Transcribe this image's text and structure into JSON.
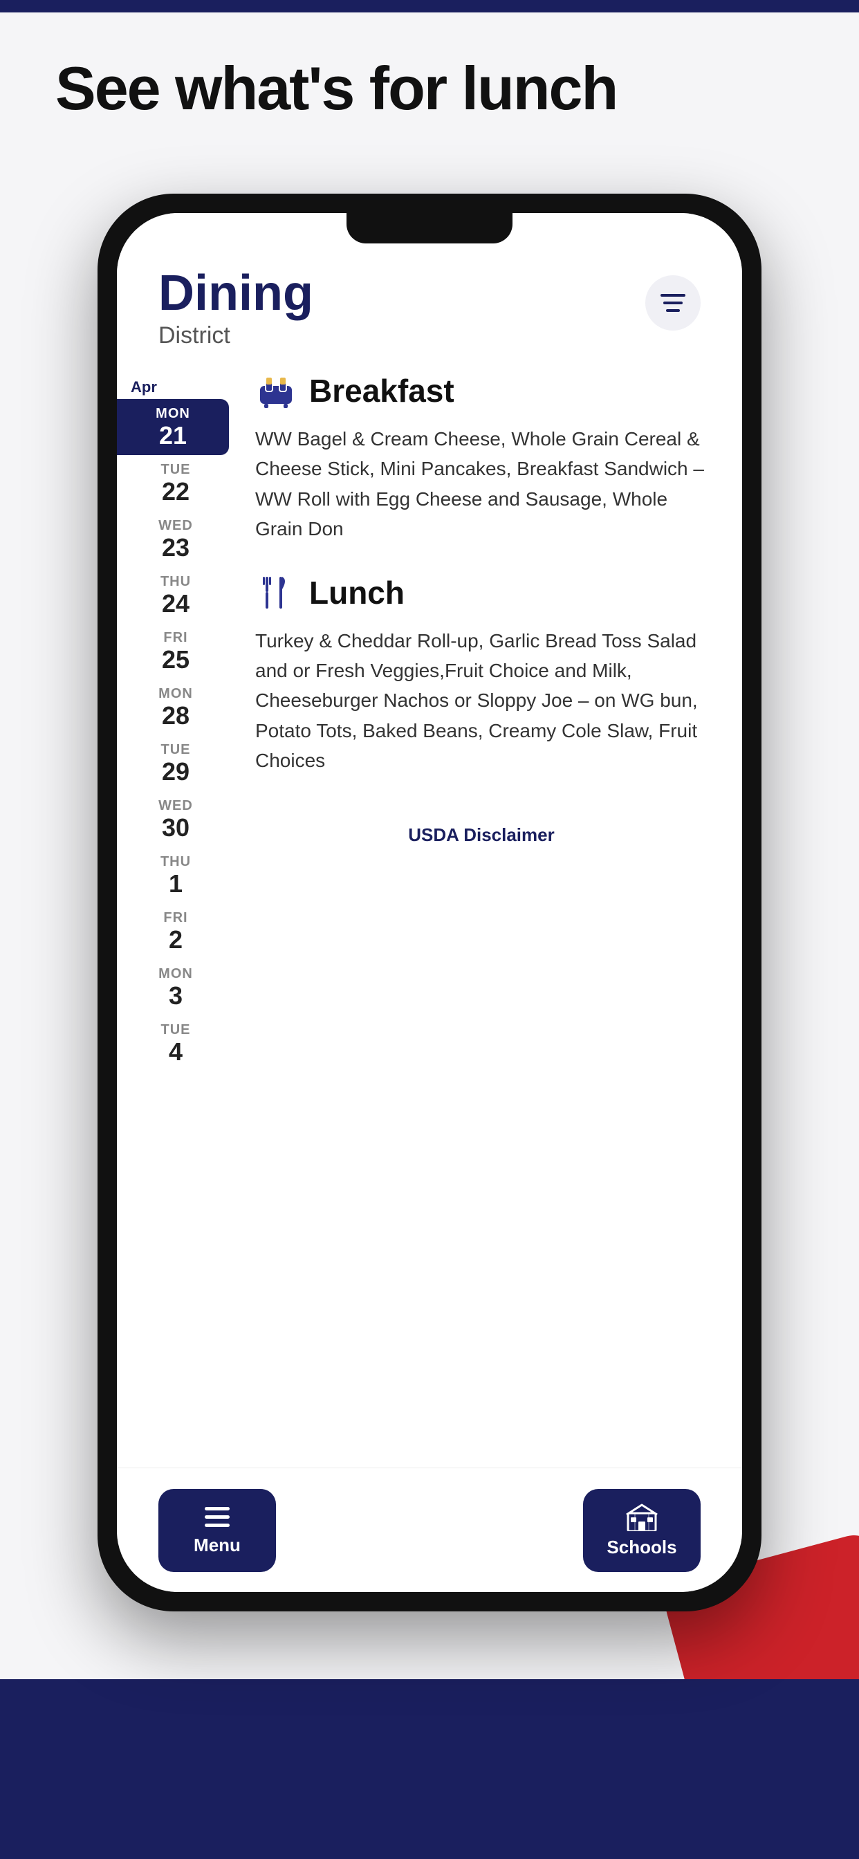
{
  "page": {
    "heading": "See what's for lunch",
    "top_bar_color": "#1a1f5e"
  },
  "app": {
    "title": "Dining",
    "subtitle": "District",
    "filter_label": "filter"
  },
  "calendar": {
    "month": "Apr",
    "days": [
      {
        "id": "mon-21",
        "day": "MON",
        "num": "21",
        "active": true
      },
      {
        "id": "tue-22",
        "day": "TUE",
        "num": "22",
        "active": false
      },
      {
        "id": "wed-23",
        "day": "WED",
        "num": "23",
        "active": false
      },
      {
        "id": "thu-24",
        "day": "THU",
        "num": "24",
        "active": false
      },
      {
        "id": "fri-25",
        "day": "FRI",
        "num": "25",
        "active": false
      },
      {
        "id": "mon-28",
        "day": "MON",
        "num": "28",
        "active": false
      },
      {
        "id": "tue-29",
        "day": "TUE",
        "num": "29",
        "active": false
      },
      {
        "id": "wed-30",
        "day": "WED",
        "num": "30",
        "active": false
      },
      {
        "id": "thu-1",
        "day": "THU",
        "num": "1",
        "active": false
      },
      {
        "id": "fri-2",
        "day": "FRI",
        "num": "2",
        "active": false
      },
      {
        "id": "mon-3",
        "day": "MON",
        "num": "3",
        "active": false
      },
      {
        "id": "tue-4",
        "day": "TUE",
        "num": "4",
        "active": false
      }
    ]
  },
  "meals": {
    "breakfast": {
      "title": "Breakfast",
      "description": "WW Bagel & Cream Cheese, Whole Grain Cereal & Cheese Stick, Mini Pancakes, Breakfast Sandwich – WW Roll with Egg Cheese and Sausage, Whole Grain Don"
    },
    "lunch": {
      "title": "Lunch",
      "description": "Turkey & Cheddar Roll-up, Garlic Bread Toss Salad and or Fresh Veggies,Fruit Choice and Milk, Cheeseburger Nachos or Sloppy Joe – on WG bun, Potato Tots, Baked Beans, Creamy Cole Slaw, Fruit Choices"
    }
  },
  "footer": {
    "usda_label": "USDA Disclaimer",
    "nav_menu_label": "Menu",
    "nav_schools_label": "Schools"
  },
  "colors": {
    "brand_dark": "#1a1f5e",
    "brand_red": "#cc2229",
    "accent_bg": "#f0f0f5"
  }
}
